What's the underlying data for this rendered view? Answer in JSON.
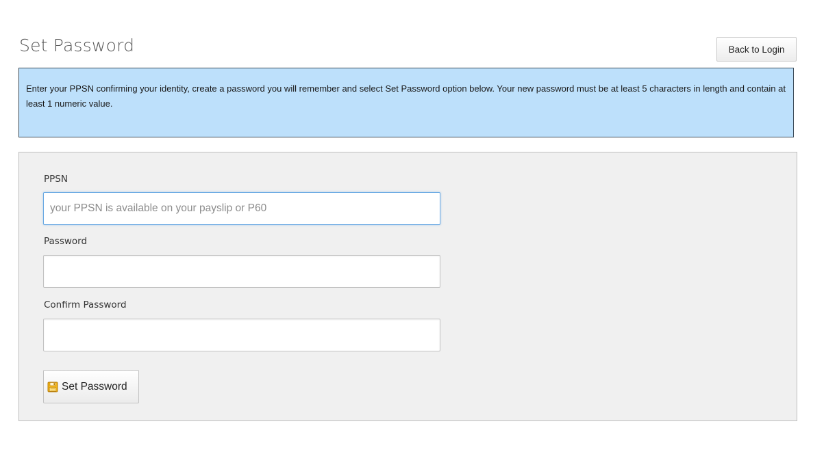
{
  "header": {
    "title": "Set Password",
    "back_label": "Back to Login"
  },
  "info": {
    "text": "Enter your PPSN confirming your identity, create a password you will remember and select Set Password option below. Your new password must be at least 5 characters in length and contain at least 1 numeric value."
  },
  "form": {
    "ppsn": {
      "label": "PPSN",
      "value": "",
      "placeholder": "your PPSN is available on your payslip or P60"
    },
    "password": {
      "label": "Password",
      "value": "",
      "placeholder": ""
    },
    "confirm_password": {
      "label": "Confirm Password",
      "value": "",
      "placeholder": ""
    },
    "submit": {
      "label": "Set Password",
      "icon": "floppy-disk-icon"
    }
  },
  "colors": {
    "info_background": "#bde0fb",
    "info_border": "#3b4a57",
    "panel_background": "#f0f0f0",
    "focus_border": "#6aa9e3",
    "icon_yellow": "#f2b418"
  }
}
